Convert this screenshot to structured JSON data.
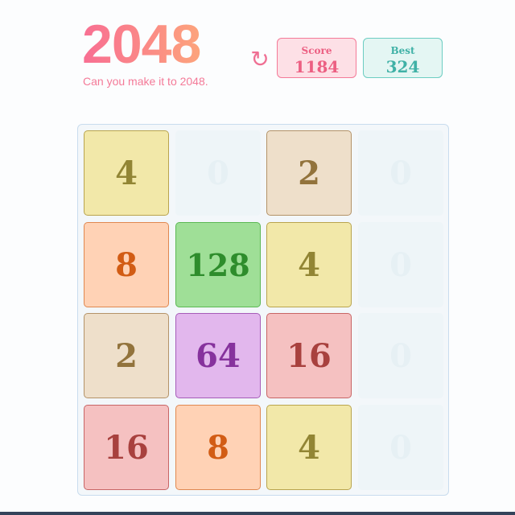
{
  "header": {
    "title": "2048",
    "subtitle": "Can you make it to 2048."
  },
  "restart": {
    "icon": "↻"
  },
  "score": {
    "label": "Score",
    "value": "1184"
  },
  "best": {
    "label": "Best",
    "value": "324"
  },
  "board": {
    "rows": [
      [
        "4",
        "0",
        "2",
        "0"
      ],
      [
        "8",
        "128",
        "4",
        "0"
      ],
      [
        "2",
        "64",
        "16",
        "0"
      ],
      [
        "16",
        "8",
        "4",
        "0"
      ]
    ]
  },
  "colors": {
    "title_gradient_start": "#f86f93",
    "title_gradient_end": "#fca47c",
    "score_accent": "#f47a98",
    "best_accent": "#6ccdc2"
  }
}
